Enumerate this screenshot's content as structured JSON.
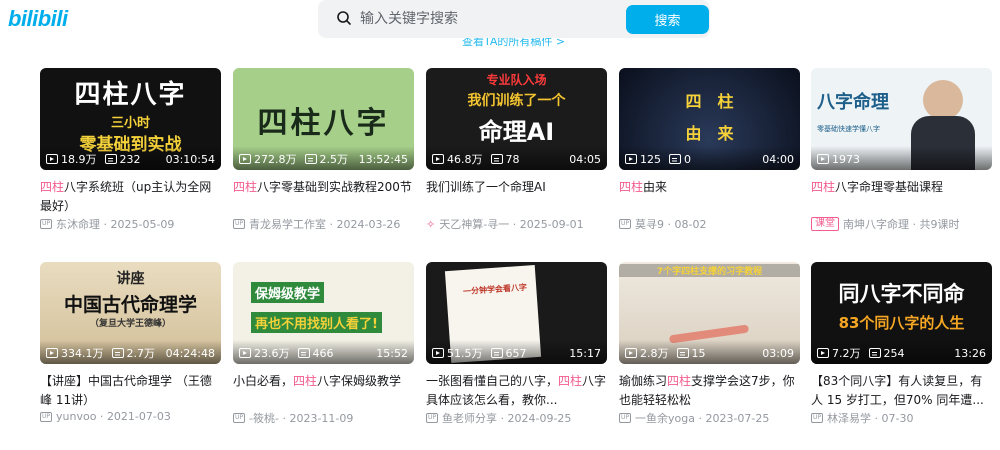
{
  "header": {
    "logo": "bilibili",
    "search_placeholder": "输入关键字搜索",
    "search_button": "搜索",
    "view_all": "查看TA的所有稿件 >"
  },
  "videos": [
    {
      "thumb_lines": [
        "四柱八字",
        "三小时",
        "零基础到实战"
      ],
      "views": "18.9万",
      "danmaku": "232",
      "duration": "03:10:54",
      "title_hl": "四柱",
      "title_rest": "八字系统班（up主认为全网最好）",
      "author": "东沐命理",
      "date": "2025-05-09",
      "tag": ""
    },
    {
      "thumb_lines": [
        "四柱八字"
      ],
      "views": "272.8万",
      "danmaku": "2.5万",
      "duration": "13:52:45",
      "title_hl": "四柱",
      "title_rest": "八字零基础到实战教程200节",
      "author": "青龙易学工作室",
      "date": "2024-03-26",
      "tag": ""
    },
    {
      "thumb_lines": [
        "专业队入场",
        "我们训练了一个",
        "命理AI"
      ],
      "views": "46.8万",
      "danmaku": "78",
      "duration": "04:05",
      "title_hl": "",
      "title_rest": "我们训练了一个命理AI",
      "author": "天乙神算-寻一",
      "date": "2025-09-01",
      "tag": ""
    },
    {
      "thumb_lines": [
        "四　柱",
        "由　来"
      ],
      "views": "125",
      "danmaku": "0",
      "duration": "04:00",
      "title_hl": "四柱",
      "title_rest": "由来",
      "author": "莫寻9",
      "date": "08-02",
      "tag": ""
    },
    {
      "thumb_lines": [
        "八字命理",
        "零基础快速学懂八字"
      ],
      "views": "1973",
      "danmaku": "",
      "duration": "",
      "title_hl": "四柱",
      "title_rest": "八字命理零基础课程",
      "author": "南坤八字命理",
      "date": "共9课时",
      "tag": "课堂"
    },
    {
      "thumb_lines": [
        "讲座",
        "中国古代命理学",
        "（复旦大学王德峰）"
      ],
      "views": "334.1万",
      "danmaku": "2.7万",
      "duration": "04:24:48",
      "title_hl": "",
      "title_rest": "【讲座】中国古代命理学 （王德峰 11讲）",
      "author": "yunvoo",
      "date": "2021-07-03",
      "tag": ""
    },
    {
      "thumb_lines": [
        "保姆级教学",
        "再也不用找别人看了!"
      ],
      "views": "23.6万",
      "danmaku": "466",
      "duration": "15:52",
      "title_hl": "四柱",
      "title_pre": "小白必看，",
      "title_rest": "八字保姆级教学",
      "author": "-筱桃-",
      "date": "2023-11-09",
      "tag": ""
    },
    {
      "thumb_lines": [
        "一分钟学会看八字"
      ],
      "views": "51.5万",
      "danmaku": "657",
      "duration": "15:17",
      "title_hl": "四柱",
      "title_pre": "一张图看懂自己的八字，",
      "title_rest": "八字具体应该怎么看，教你...",
      "author": "鱼老师分享",
      "date": "2024-09-25",
      "tag": ""
    },
    {
      "thumb_lines": [
        "7个字四柱支撑的习字教程"
      ],
      "views": "2.8万",
      "danmaku": "15",
      "duration": "03:09",
      "title_hl": "四柱",
      "title_pre": "瑜伽练习",
      "title_rest": "支撑学会这7步，你也能轻轻松松",
      "author": "一鱼余yoga",
      "date": "2023-07-25",
      "tag": ""
    },
    {
      "thumb_lines": [
        "同八字不同命",
        "83个同八字的人生"
      ],
      "views": "7.2万",
      "danmaku": "254",
      "duration": "13:26",
      "title_hl": "",
      "title_rest": "【83个同八字】有人读复旦，有人 15 岁打工，但70% 同年遭...",
      "author": "林泽易学",
      "date": "07-30",
      "tag": ""
    }
  ]
}
